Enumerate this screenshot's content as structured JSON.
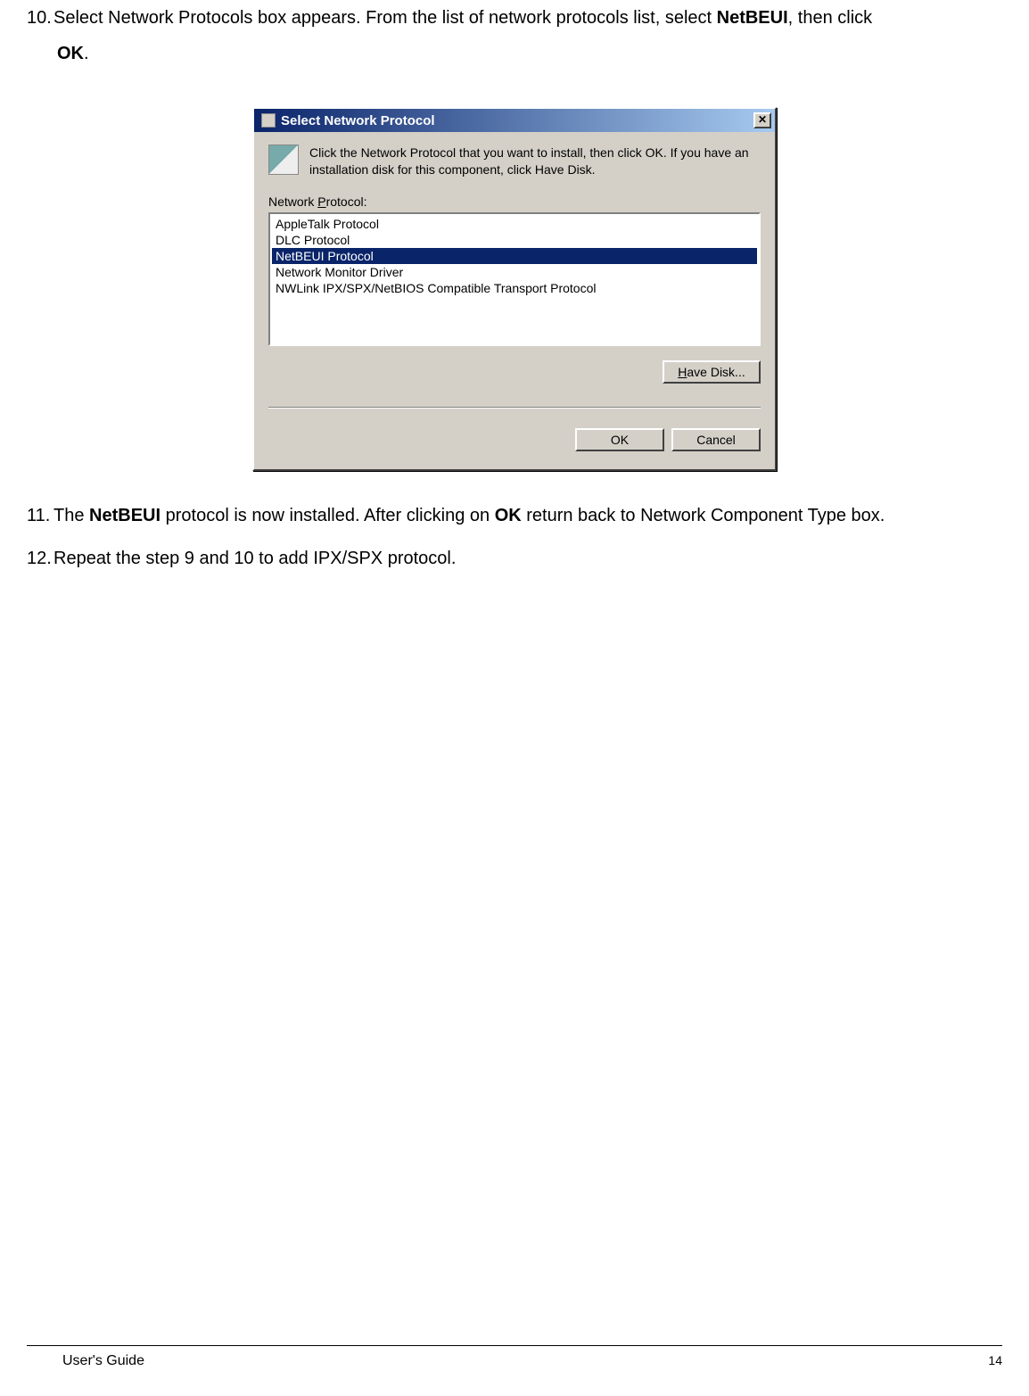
{
  "steps": {
    "s10_num": "10.",
    "s10_a": "Select Network Protocols box appears.  From the list of network protocols list, select ",
    "s10_b": "NetBEUI",
    "s10_c": ", then click ",
    "s10_d": "OK",
    "s10_e": ".",
    "s11_num": "11.",
    "s11_a": "The ",
    "s11_b": "NetBEUI",
    "s11_c": " protocol is now installed. After clicking on ",
    "s11_d": "OK",
    "s11_e": " return back to Network Component Type box.",
    "s12_num": "12.",
    "s12_a": "Repeat the step 9 and 10 to add IPX/SPX protocol."
  },
  "dialog": {
    "title": "Select Network Protocol",
    "close": "✕",
    "info": "Click the Network Protocol that you want to install, then click OK. If you have an installation disk for this component, click Have Disk.",
    "list_label_pre": "Network ",
    "list_label_u": "P",
    "list_label_post": "rotocol:",
    "items": {
      "0": "AppleTalk Protocol",
      "1": "DLC Protocol",
      "2": "NetBEUI Protocol",
      "3": "Network Monitor Driver",
      "4": "NWLink IPX/SPX/NetBIOS Compatible Transport Protocol"
    },
    "have_disk_u": "H",
    "have_disk_post": "ave Disk...",
    "ok": "OK",
    "cancel": "Cancel"
  },
  "footer": {
    "guide": "User's Guide",
    "page": "14"
  }
}
